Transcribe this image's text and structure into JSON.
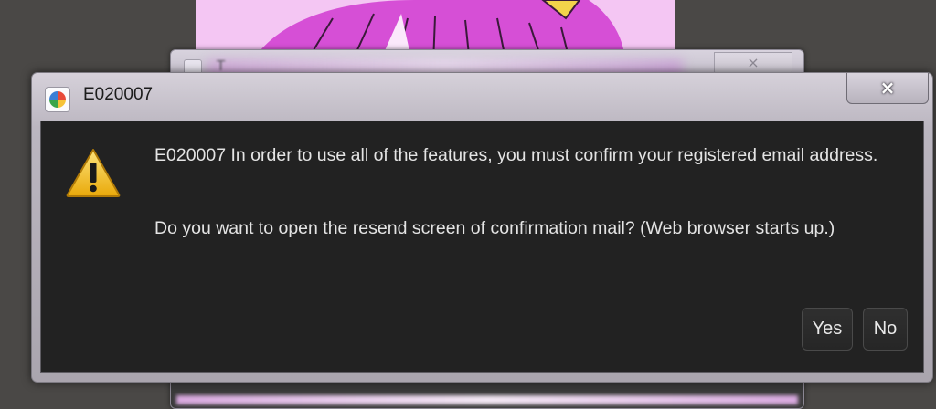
{
  "background_window": {
    "close_label": "×"
  },
  "dialog": {
    "title": "E020007",
    "close_label": "×",
    "message_line1": "E020007 In order to use all of the features, you must confirm your registered email address.",
    "message_line2": "Do you want to open the resend screen of confirmation mail? (Web browser starts up.)",
    "yes_label": "Yes",
    "no_label": "No"
  },
  "colors": {
    "desktop": "#4a4846",
    "dialog_client": "#222222",
    "warning_yellow": "#f3c21b"
  },
  "icons": [
    "app-logo-icon",
    "warning-icon",
    "close-icon"
  ]
}
